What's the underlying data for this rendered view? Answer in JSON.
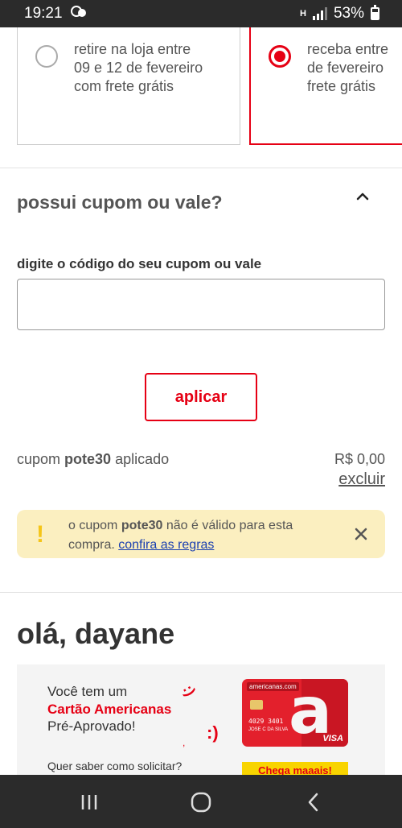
{
  "status_bar": {
    "time": "19:21",
    "battery": "53%",
    "network": "H"
  },
  "delivery": {
    "option_pickup": {
      "text": "retire na loja entre\n09 e 12 de fevereiro\ncom frete grátis",
      "selected": false
    },
    "option_delivery": {
      "text": "receba entre\nde fevereiro\nfrete grátis",
      "selected": true
    }
  },
  "coupon": {
    "title": "possui cupom ou vale?",
    "field_label": "digite o código do seu cupom ou vale",
    "input_value": "",
    "input_placeholder": "",
    "apply_label": "aplicar",
    "applied_prefix": "cupom ",
    "applied_code": "pote30",
    "applied_suffix": " aplicado",
    "applied_value": "R$ 0,00",
    "remove_label": "excluir"
  },
  "alert": {
    "icon": "!",
    "text_prefix": "o cupom ",
    "code": "pote30",
    "text_suffix": " não é válido para esta compra. ",
    "link_label": "confira as regras"
  },
  "greeting": "olá, dayane",
  "banner": {
    "line1": "Você tem um",
    "line2": "Cartão Americanas",
    "line3": "Pré-Aprovado!",
    "question": "Quer saber como solicitar?",
    "cta": "Chega maaais!",
    "card_brand": "americanas.com",
    "card_number": "4029 3401",
    "card_name": "JOSE C DA SILVA",
    "card_network": "VISA"
  },
  "colors": {
    "brand_red": "#e60014",
    "alert_bg": "#fbefc0",
    "alert_icon": "#f5c518",
    "link_blue": "#1a3fb0"
  }
}
